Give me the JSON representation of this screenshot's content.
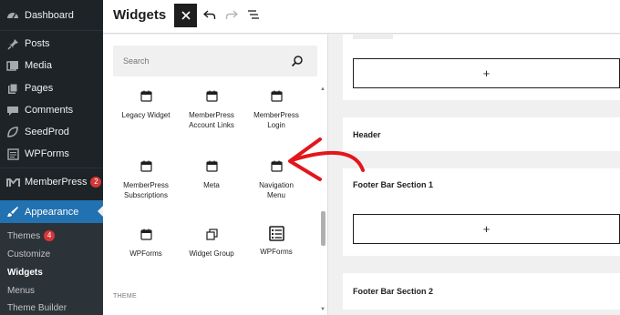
{
  "sidebar": {
    "items": [
      {
        "label": "Dashboard",
        "icon": "dashboard-icon"
      },
      {
        "label": "Posts",
        "icon": "pushpin-icon"
      },
      {
        "label": "Media",
        "icon": "media-icon"
      },
      {
        "label": "Pages",
        "icon": "pages-icon"
      },
      {
        "label": "Comments",
        "icon": "comment-icon"
      },
      {
        "label": "SeedProd",
        "icon": "seedprod-icon"
      },
      {
        "label": "WPForms",
        "icon": "wpforms-icon"
      },
      {
        "label": "MemberPress",
        "icon": "memberpress-icon",
        "badge": "2"
      },
      {
        "label": "Appearance",
        "icon": "paintbrush-icon"
      }
    ],
    "submenu": [
      {
        "label": "Themes",
        "badge": "4"
      },
      {
        "label": "Customize"
      },
      {
        "label": "Widgets"
      },
      {
        "label": "Menus"
      },
      {
        "label": "Theme Builder"
      }
    ],
    "active_color": "#2271b1"
  },
  "topbar": {
    "title": "Widgets",
    "close_icon": "close-icon",
    "undo_icon": "undo-icon",
    "redo_icon": "redo-icon",
    "list_view_icon": "list-view-icon"
  },
  "inserter": {
    "search_placeholder": "Search",
    "blocks": [
      {
        "label": "Legacy Widget",
        "icon": "calendar-icon"
      },
      {
        "label": "MemberPress Account Links",
        "icon": "calendar-icon"
      },
      {
        "label": "MemberPress Login",
        "icon": "calendar-icon"
      },
      {
        "label": "MemberPress Subscriptions",
        "icon": "calendar-icon"
      },
      {
        "label": "Meta",
        "icon": "calendar-icon"
      },
      {
        "label": "Navigation Menu",
        "icon": "calendar-icon"
      },
      {
        "label": "WPForms",
        "icon": "calendar-icon"
      },
      {
        "label": "Widget Group",
        "icon": "widget-group-icon"
      },
      {
        "label": "WPForms",
        "icon": "wpforms-form-icon"
      }
    ],
    "section_label": "THEME"
  },
  "editor": {
    "areas": [
      {
        "title": "Header"
      },
      {
        "title": "Footer Bar Section 1"
      },
      {
        "title": "Footer Bar Section 2"
      }
    ],
    "appender_label": "+"
  },
  "annotation": {
    "color": "#e3161c"
  }
}
